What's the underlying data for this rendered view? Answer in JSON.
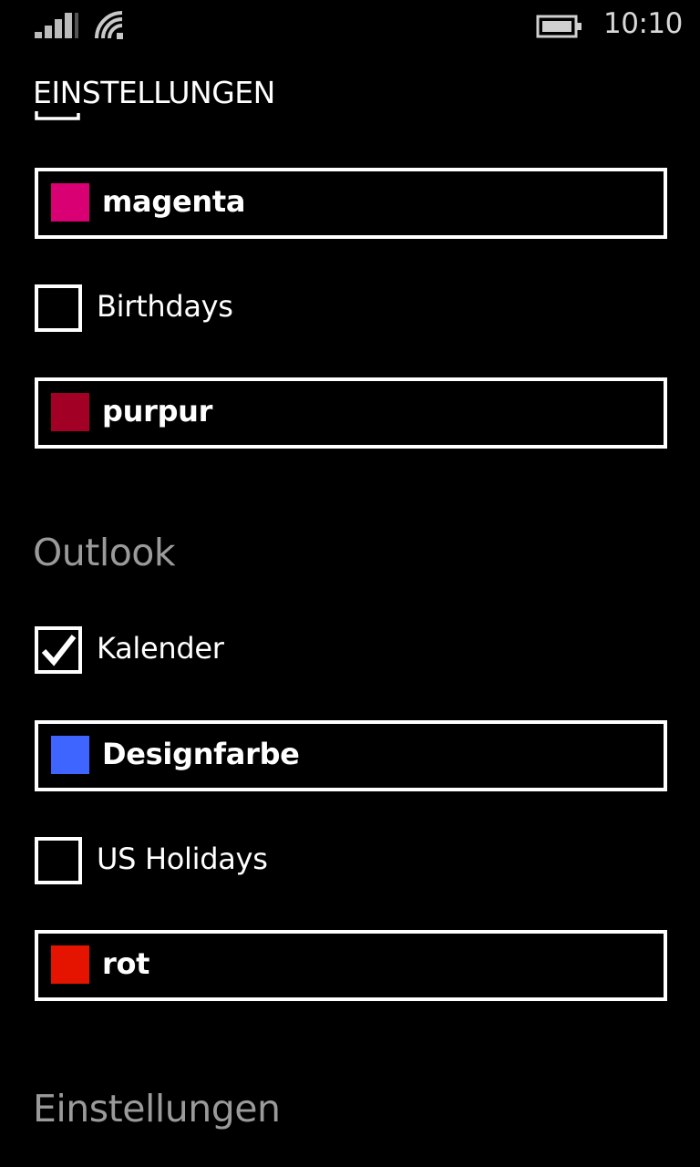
{
  "status_bar": {
    "time": "10:10",
    "icons": [
      "signal-strength-icon",
      "wifi-icon",
      "battery-icon"
    ]
  },
  "header": {
    "title": "EINSTELLUNGEN"
  },
  "accounts": [
    {
      "name": "account-1",
      "calendars": [
        {
          "color_label": "magenta",
          "color": "#D80073"
        },
        {
          "checkbox_label": "Birthdays",
          "checked": false
        },
        {
          "color_label": "purpur",
          "color": "#A20025"
        }
      ]
    }
  ],
  "sections": {
    "outlook": {
      "label": "Outlook",
      "kalender": {
        "label": "Kalender",
        "checked": true
      },
      "kalender_color": {
        "label": "Designfarbe",
        "color": "#3E65FF"
      },
      "holidays": {
        "label": "US Holidays",
        "checked": false
      },
      "holidays_color": {
        "label": "rot",
        "color": "#E51400"
      }
    },
    "settings": {
      "label": "Einstellungen"
    }
  },
  "colors": {
    "background": "#000000",
    "foreground": "#FFFFFF",
    "section_header": "#9A9A9A"
  }
}
